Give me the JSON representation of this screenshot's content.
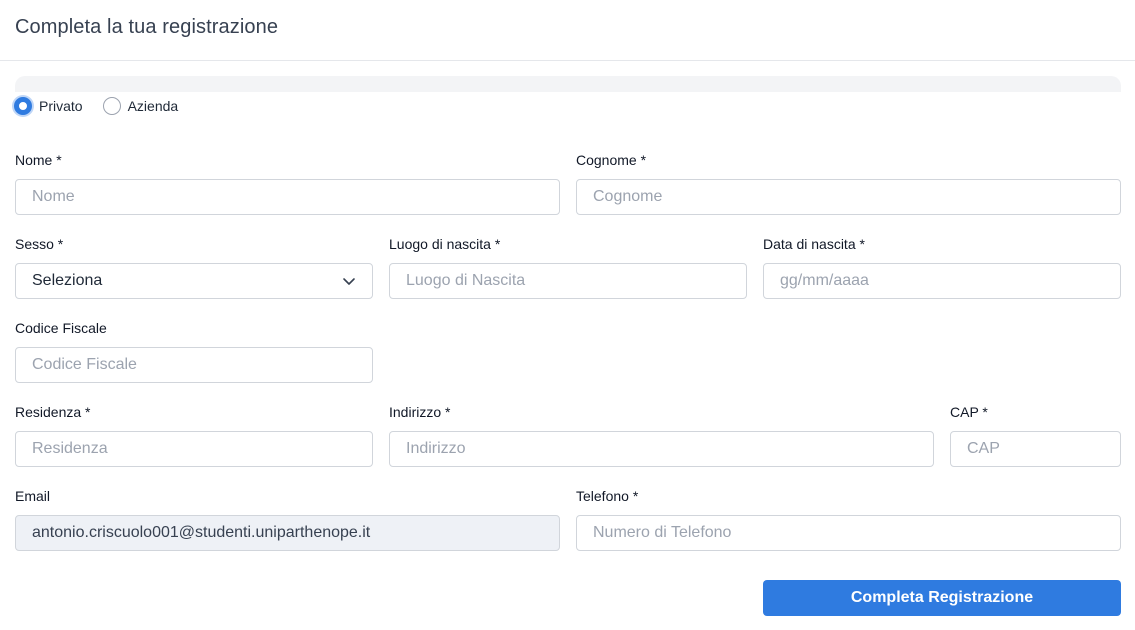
{
  "header": {
    "title": "Completa la tua registrazione"
  },
  "account_type": {
    "options": [
      {
        "label": "Privato",
        "selected": true
      },
      {
        "label": "Azienda",
        "selected": false
      }
    ]
  },
  "form": {
    "nome": {
      "label": "Nome *",
      "placeholder": "Nome",
      "value": ""
    },
    "cognome": {
      "label": "Cognome *",
      "placeholder": "Cognome",
      "value": ""
    },
    "sesso": {
      "label": "Sesso *",
      "selected": "Seleziona"
    },
    "luogo_nascita": {
      "label": "Luogo di nascita *",
      "placeholder": "Luogo di Nascita",
      "value": ""
    },
    "data_nascita": {
      "label": "Data di nascita *",
      "placeholder": "gg/mm/aaaa",
      "value": ""
    },
    "codice_fiscale": {
      "label": "Codice Fiscale",
      "placeholder": "Codice Fiscale",
      "value": ""
    },
    "residenza": {
      "label": "Residenza *",
      "placeholder": "Residenza",
      "value": ""
    },
    "indirizzo": {
      "label": "Indirizzo *",
      "placeholder": "Indirizzo",
      "value": ""
    },
    "cap": {
      "label": "CAP *",
      "placeholder": "CAP",
      "value": ""
    },
    "email": {
      "label": "Email",
      "value": "antonio.criscuolo001@studenti.uniparthenope.it"
    },
    "telefono": {
      "label": "Telefono *",
      "placeholder": "Numero di Telefono",
      "value": ""
    }
  },
  "submit": {
    "label": "Completa Registrazione"
  },
  "colors": {
    "primary": "#2f7be0",
    "border": "#d1d5db",
    "placeholder": "#9ca3af",
    "disabled_bg": "#eef1f6"
  }
}
